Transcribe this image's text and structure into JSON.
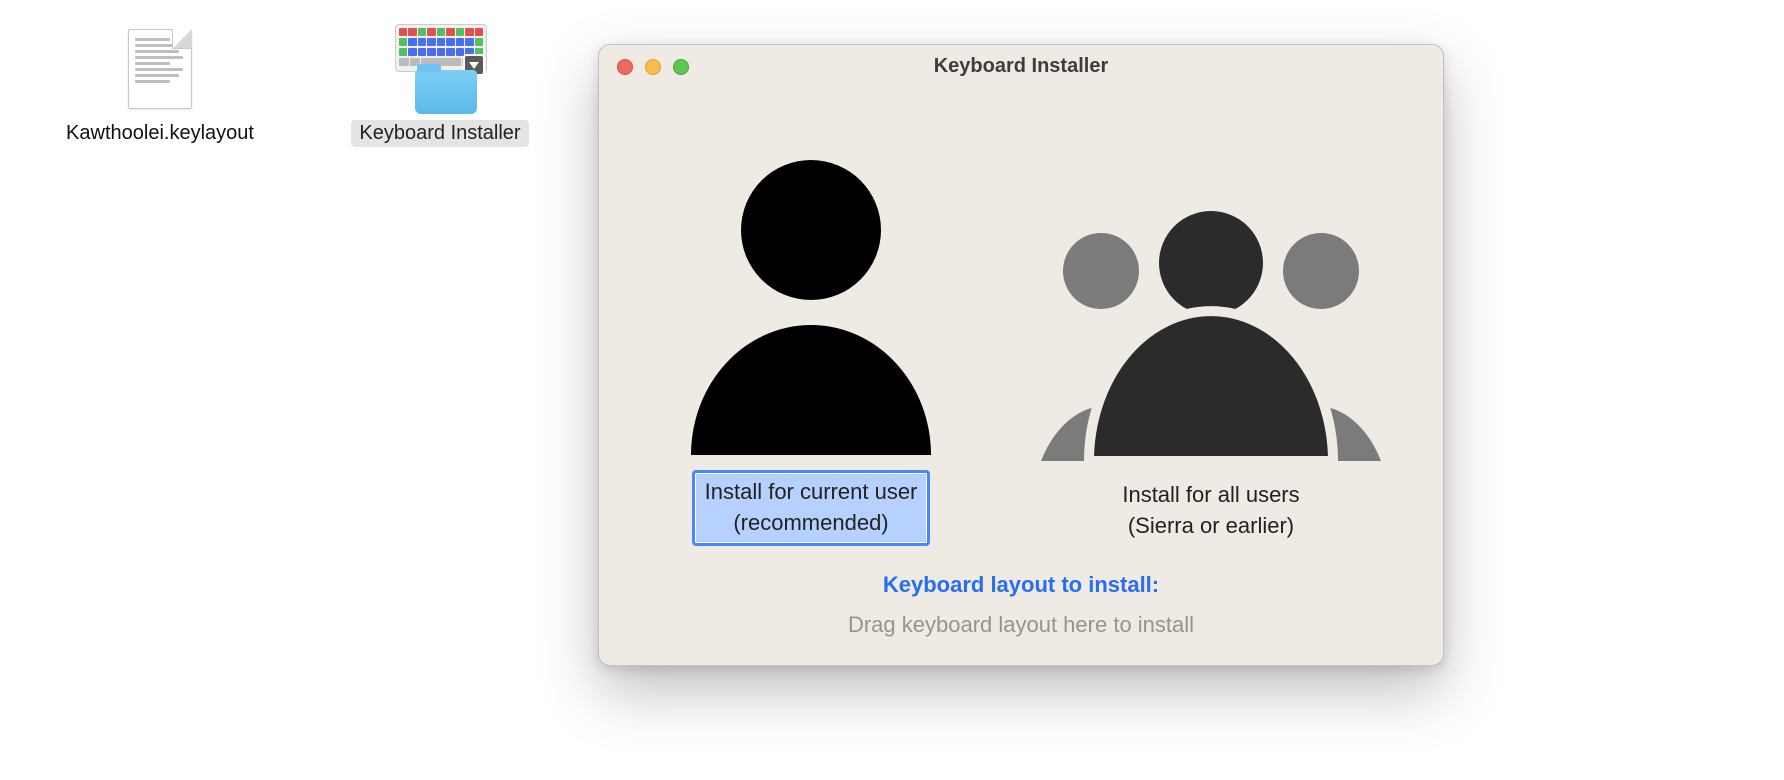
{
  "desktop": {
    "items": [
      {
        "label": "Kawthoolei.keylayout",
        "icon": "textfile-icon",
        "selected": false
      },
      {
        "label": "Keyboard Installer",
        "icon": "installer-app-icon",
        "selected": true
      }
    ]
  },
  "window": {
    "title": "Keyboard Installer",
    "choices": [
      {
        "line1": "Install for current user",
        "line2": "(recommended)",
        "icon": "single-user-icon",
        "selected": true
      },
      {
        "line1": "Install for all users",
        "line2": "(Sierra or earlier)",
        "icon": "group-users-icon",
        "selected": false
      }
    ],
    "section_heading": "Keyboard layout to install:",
    "drop_hint": "Drag keyboard layout here to install"
  },
  "colors": {
    "accent": "#276ef1",
    "selection_bg": "#b6d1ff",
    "selection_border": "#4a87ff",
    "window_bg": "#efeae4"
  }
}
